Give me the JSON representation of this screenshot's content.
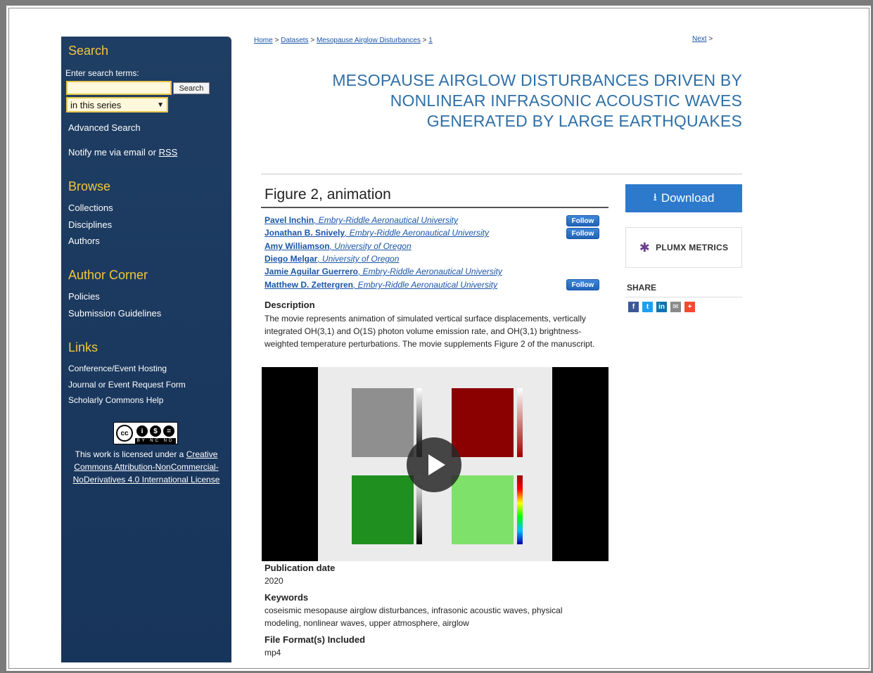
{
  "sidebar": {
    "search": {
      "heading": "Search",
      "label": "Enter search terms:",
      "input_value": "",
      "button_label": "Search",
      "scope_selected": "in this series",
      "advanced_search": "Advanced Search",
      "notify_text": "Notify me via email or ",
      "rss": "RSS"
    },
    "browse": {
      "heading": "Browse",
      "items": [
        "Collections",
        "Disciplines",
        "Authors"
      ]
    },
    "author_corner": {
      "heading": "Author Corner",
      "items": [
        "Policies",
        "Submission Guidelines"
      ]
    },
    "links": {
      "heading": "Links",
      "items": [
        "Conference/Event Hosting",
        "Journal or Event Request Form",
        "Scholarly Commons Help"
      ]
    },
    "license": {
      "badge": {
        "cc": "cc",
        "by": "i",
        "nc": "$",
        "nd": "=",
        "bar": "BY NC ND"
      },
      "prefix": "This work is licensed under a ",
      "link_text": "Creative Commons Attribution-NonCommercial-NoDerivatives 4.0 International License"
    }
  },
  "breadcrumb": {
    "home": "Home",
    "datasets": "Datasets",
    "series": "Mesopause Airglow Disturbances",
    "current": "1",
    "sep": " > "
  },
  "next_link": "Next",
  "next_suffix": " >",
  "title_lines": [
    "MESOPAUSE AIRGLOW DISTURBANCES DRIVEN BY",
    "NONLINEAR INFRASONIC ACOUSTIC WAVES",
    "GENERATED BY LARGE EARTHQUAKES"
  ],
  "figure_title": "Figure 2, animation",
  "authors": [
    {
      "name": "Pavel Inchin",
      "affiliation": ", Embry-Riddle Aeronautical University",
      "follow": "Follow"
    },
    {
      "name": "Jonathan B. Snively",
      "affiliation": ", Embry-Riddle Aeronautical University",
      "follow": "Follow"
    },
    {
      "name": "Amy Williamson",
      "affiliation": ", University of Oregon",
      "follow": ""
    },
    {
      "name": "Diego Melgar",
      "affiliation": ", University of Oregon",
      "follow": ""
    },
    {
      "name": "Jamie Aguilar Guerrero",
      "affiliation": ", Embry-Riddle Aeronautical University",
      "follow": ""
    },
    {
      "name": "Matthew D. Zettergren",
      "affiliation": ", Embry-Riddle Aeronautical University",
      "follow": "Follow"
    }
  ],
  "description": {
    "heading": "Description",
    "lines": [
      "The movie represents animation of simulated vertical surface displacements, vertically",
      "integrated OH(3,1) and O(1S) photon volume emission rate, and OH(3,1) brightness-",
      "weighted temperature perturbations. The movie supplements Figure 2 of the manuscript."
    ]
  },
  "publication_date": {
    "heading": "Publication date",
    "value": "2020"
  },
  "keywords": {
    "heading": "Keywords",
    "lines": [
      "coseismic mesopause airglow disturbances, infrasonic acoustic waves, physical",
      "modeling, nonlinear waves, upper atmosphere, airglow"
    ]
  },
  "file_format": {
    "heading": "File Format(s) Included",
    "value": "mp4"
  },
  "right": {
    "download": "Download",
    "plumx": "PLUMX METRICS",
    "share_label": "SHARE",
    "share_icons": [
      {
        "name": "facebook-icon",
        "glyph": "f",
        "color": "#3b5998"
      },
      {
        "name": "twitter-icon",
        "glyph": "t",
        "color": "#1da1f2"
      },
      {
        "name": "linkedin-icon",
        "glyph": "in",
        "color": "#0e76a8"
      },
      {
        "name": "email-icon",
        "glyph": "✉",
        "color": "#8a8a8a"
      },
      {
        "name": "addthis-icon",
        "glyph": "+",
        "color": "#f24a32"
      }
    ]
  },
  "colors": {
    "sidebar_bg": "#1f3e63",
    "sidebar_heading": "#f2c63a",
    "title": "#2f6fa6",
    "link": "#1a55a8",
    "download": "#2d79cc"
  }
}
